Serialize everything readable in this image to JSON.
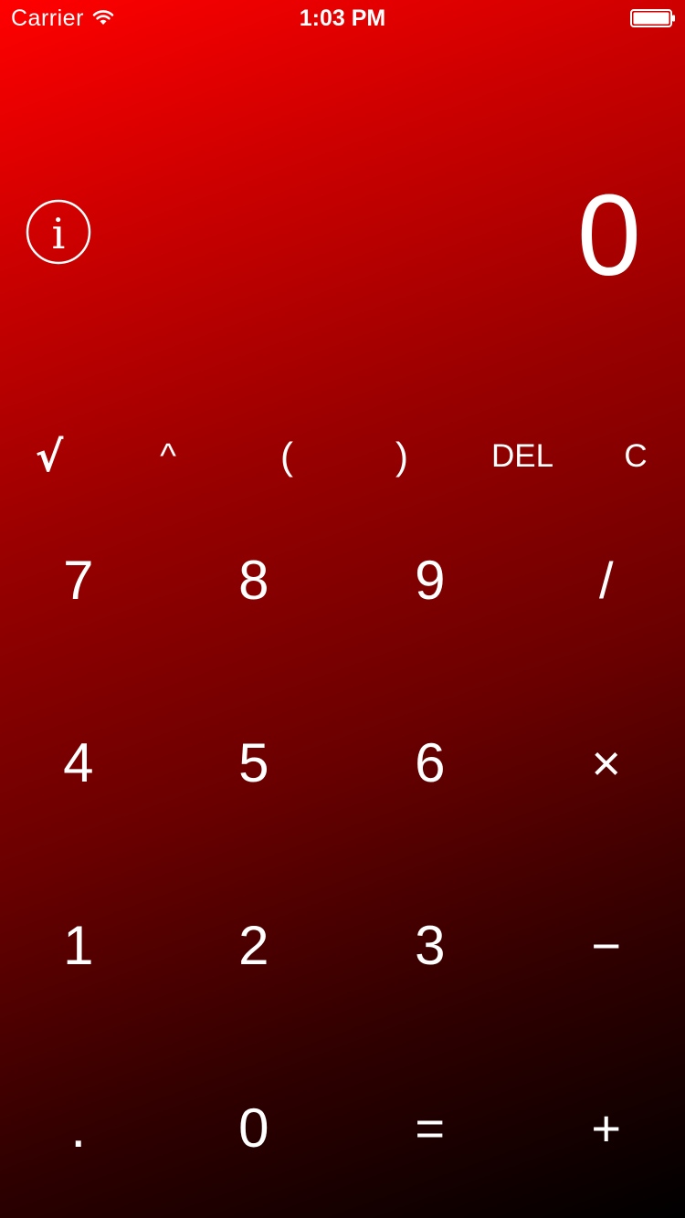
{
  "status_bar": {
    "carrier": "Carrier",
    "time": "1:03 PM"
  },
  "display": {
    "value": "0"
  },
  "info_button": {
    "icon": "info-icon",
    "glyph": "i"
  },
  "function_row": [
    {
      "label": "√",
      "name": "sqrt-button"
    },
    {
      "label": "^",
      "name": "power-button"
    },
    {
      "label": "(",
      "name": "open-paren-button"
    },
    {
      "label": ")",
      "name": "close-paren-button"
    },
    {
      "label": "DEL",
      "name": "delete-button"
    },
    {
      "label": "C",
      "name": "clear-button"
    }
  ],
  "keypad": [
    [
      {
        "label": "7",
        "name": "key-7"
      },
      {
        "label": "8",
        "name": "key-8"
      },
      {
        "label": "9",
        "name": "key-9"
      },
      {
        "label": "/",
        "name": "divide-button"
      }
    ],
    [
      {
        "label": "4",
        "name": "key-4"
      },
      {
        "label": "5",
        "name": "key-5"
      },
      {
        "label": "6",
        "name": "key-6"
      },
      {
        "label": "×",
        "name": "multiply-button"
      }
    ],
    [
      {
        "label": "1",
        "name": "key-1"
      },
      {
        "label": "2",
        "name": "key-2"
      },
      {
        "label": "3",
        "name": "key-3"
      },
      {
        "label": "−",
        "name": "subtract-button"
      }
    ],
    [
      {
        "label": ".",
        "name": "decimal-button"
      },
      {
        "label": "0",
        "name": "key-0"
      },
      {
        "label": "=",
        "name": "equals-button"
      },
      {
        "label": "+",
        "name": "add-button"
      }
    ]
  ],
  "colors": {
    "gradient_start": "#ff0000",
    "gradient_end": "#000000",
    "text": "#ffffff"
  }
}
